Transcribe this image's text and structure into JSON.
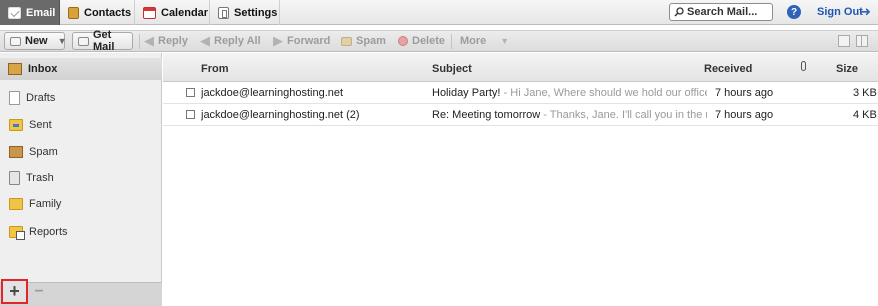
{
  "nav": {
    "tabs": [
      {
        "label": "Email",
        "active": true,
        "icon": "envelope-icon"
      },
      {
        "label": "Contacts",
        "active": false,
        "icon": "address-book-icon"
      },
      {
        "label": "Calendar",
        "active": false,
        "icon": "calendar-icon"
      },
      {
        "label": "Settings",
        "active": false,
        "icon": "settings-icon"
      }
    ],
    "search_placeholder": "Search Mail...",
    "help_label": "?",
    "sign_out_label": "Sign Out"
  },
  "toolbar": {
    "new_label": "New",
    "get_mail_label": "Get Mail",
    "reply_label": "Reply",
    "reply_all_label": "Reply All",
    "forward_label": "Forward",
    "spam_label": "Spam",
    "delete_label": "Delete",
    "more_label": "More"
  },
  "sidebar": {
    "inbox_label": "Inbox",
    "folders": [
      {
        "label": "Drafts",
        "icon": "draft-icon"
      },
      {
        "label": "Sent",
        "icon": "sent-folder-icon"
      },
      {
        "label": "Spam",
        "icon": "spam-folder-icon"
      },
      {
        "label": "Trash",
        "icon": "trash-icon"
      },
      {
        "label": "Family",
        "icon": "folder-icon"
      },
      {
        "label": "Reports",
        "icon": "folder-icon"
      }
    ],
    "add_label": "+",
    "remove_label": "−"
  },
  "list": {
    "columns": {
      "from": "From",
      "subject": "Subject",
      "received": "Received",
      "size": "Size"
    },
    "messages": [
      {
        "from": "jackdoe@learninghosting.net",
        "subject": "Holiday Party!",
        "preview": " - Hi Jane, Where should we hold our office party this y",
        "received": "7 hours ago",
        "size": "3 KB"
      },
      {
        "from": "jackdoe@learninghosting.net (2)",
        "subject": "Re: Meeting tomorrow",
        "preview": " - Thanks, Jane.  I'll call you in the morning. J",
        "received": "7 hours ago",
        "size": "4 KB"
      }
    ]
  },
  "colors": {
    "active_tab": "#6a6a6a",
    "link_blue": "#1f56b3",
    "highlight_red": "#e0262a"
  }
}
